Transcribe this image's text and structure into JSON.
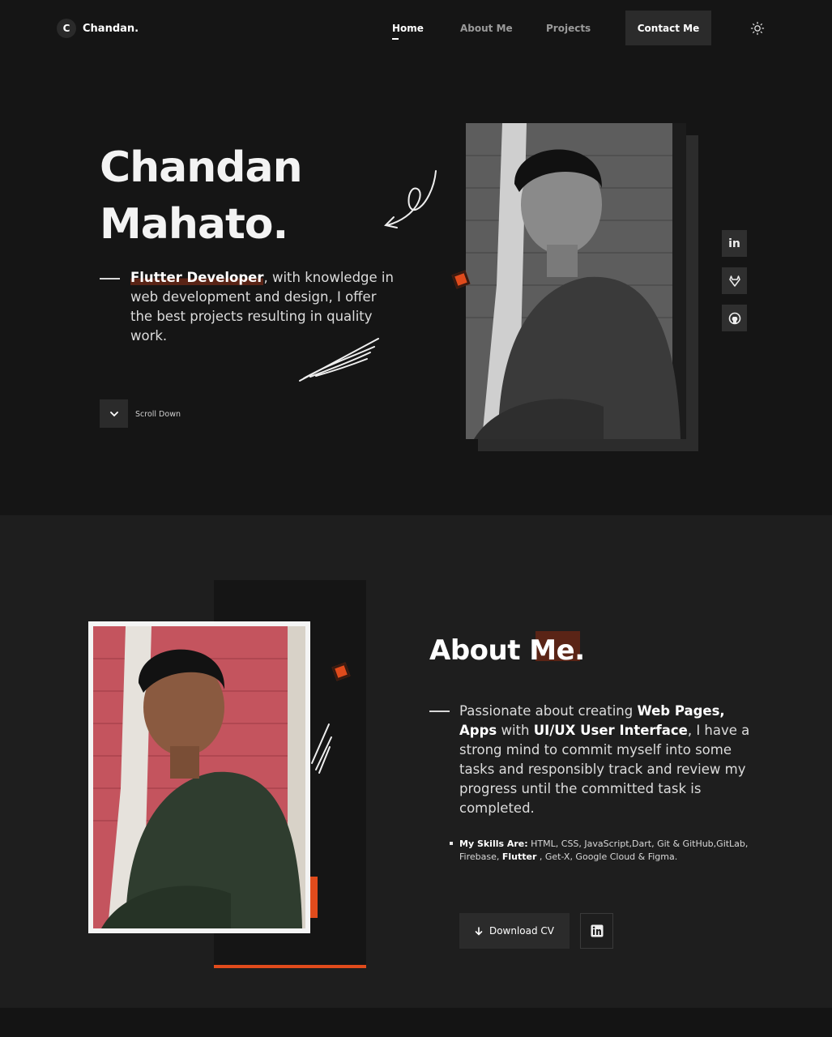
{
  "nav": {
    "logo_letter": "C",
    "logo_text": "Chandan.",
    "links": [
      "Home",
      "About Me",
      "Projects"
    ],
    "contact": "Contact Me",
    "theme_icon": "sun-icon"
  },
  "hero": {
    "name_line1": "Chandan",
    "name_line2": "Mahato.",
    "role": "Flutter Developer",
    "desc_rest": ", with knowledge in web development and design, I offer the best projects resulting in quality work.",
    "scroll_label": "Scroll Down",
    "social_icons": [
      "linkedin-icon",
      "gitlab-icon",
      "github-icon"
    ]
  },
  "about": {
    "title": "About Me.",
    "desc_1": "Passionate about creating ",
    "desc_b1": "Web Pages, Apps",
    "desc_2": " with ",
    "desc_b2": "UI/UX User Interface",
    "desc_3": ", I have a strong mind to commit myself into some tasks and responsibly track and review my progress until the committed task is completed.",
    "skills_label": "My Skills Are:",
    "skills_1": " HTML, CSS, JavaScript,Dart, Git & GitHub,GitLab, Firebase, ",
    "skills_b": "Flutter",
    "skills_2": " , Get-X, Google Cloud & Figma.",
    "cv_button": "Download CV"
  },
  "colors": {
    "accent": "#e04b1c",
    "background": "#151515",
    "section_bg": "#1e1e1e"
  }
}
